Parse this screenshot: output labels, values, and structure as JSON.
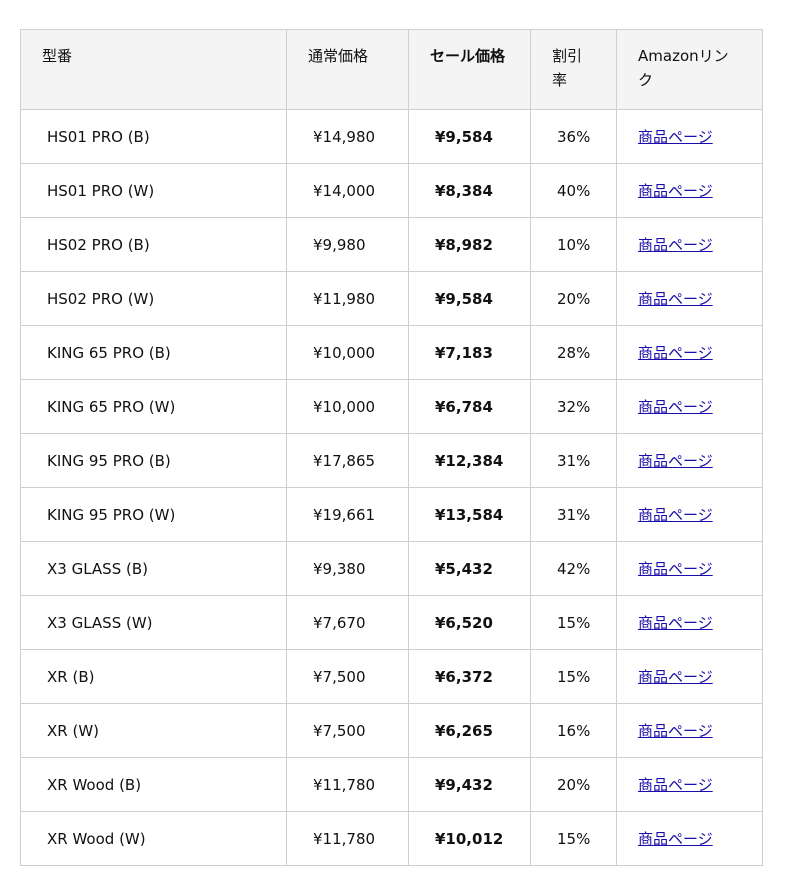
{
  "table": {
    "headers": {
      "model": "型番",
      "regular_price": "通常価格",
      "sale_price": "セール価格",
      "discount": "割引率",
      "link": "Amazonリンク"
    },
    "rows": [
      {
        "model": "HS01  PRO (B)",
        "regular_price": "¥14,980",
        "sale_price": "¥9,584",
        "discount": "36%",
        "link": "商品ページ"
      },
      {
        "model": "HS01  PRO (W)",
        "regular_price": "¥14,000",
        "sale_price": "¥8,384",
        "discount": "40%",
        "link": "商品ページ"
      },
      {
        "model": "HS02  PRO (B)",
        "regular_price": "¥9,980",
        "sale_price": "¥8,982",
        "discount": "10%",
        "link": "商品ページ"
      },
      {
        "model": "HS02  PRO (W)",
        "regular_price": "¥11,980",
        "sale_price": "¥9,584",
        "discount": "20%",
        "link": "商品ページ"
      },
      {
        "model": "KING 65  PRO (B)",
        "regular_price": "¥10,000",
        "sale_price": "¥7,183",
        "discount": "28%",
        "link": "商品ページ"
      },
      {
        "model": "KING 65  PRO (W)",
        "regular_price": "¥10,000",
        "sale_price": "¥6,784",
        "discount": "32%",
        "link": "商品ページ"
      },
      {
        "model": "KING 95  PRO (B)",
        "regular_price": "¥17,865",
        "sale_price": "¥12,384",
        "discount": "31%",
        "link": "商品ページ"
      },
      {
        "model": "KING 95  PRO (W)",
        "regular_price": "¥19,661",
        "sale_price": "¥13,584",
        "discount": "31%",
        "link": "商品ページ"
      },
      {
        "model": "X3  GLASS (B)",
        "regular_price": "¥9,380",
        "sale_price": "¥5,432",
        "discount": "42%",
        "link": "商品ページ"
      },
      {
        "model": "X3  GLASS (W)",
        "regular_price": "¥7,670",
        "sale_price": "¥6,520",
        "discount": "15%",
        "link": "商品ページ"
      },
      {
        "model": "XR (B)",
        "regular_price": "¥7,500",
        "sale_price": "¥6,372",
        "discount": "15%",
        "link": "商品ページ"
      },
      {
        "model": "XR (W)",
        "regular_price": "¥7,500",
        "sale_price": "¥6,265",
        "discount": "16%",
        "link": "商品ページ"
      },
      {
        "model": "XR Wood  (B)",
        "regular_price": "¥11,780",
        "sale_price": "¥9,432",
        "discount": "20%",
        "link": "商品ページ"
      },
      {
        "model": "XR Wood  (W)",
        "regular_price": "¥11,780",
        "sale_price": "¥10,012",
        "discount": "15%",
        "link": "商品ページ"
      }
    ]
  },
  "colors": {
    "header_bg": "#f4f4f4",
    "border": "#cfcfcf",
    "link": "#1a0dab"
  }
}
